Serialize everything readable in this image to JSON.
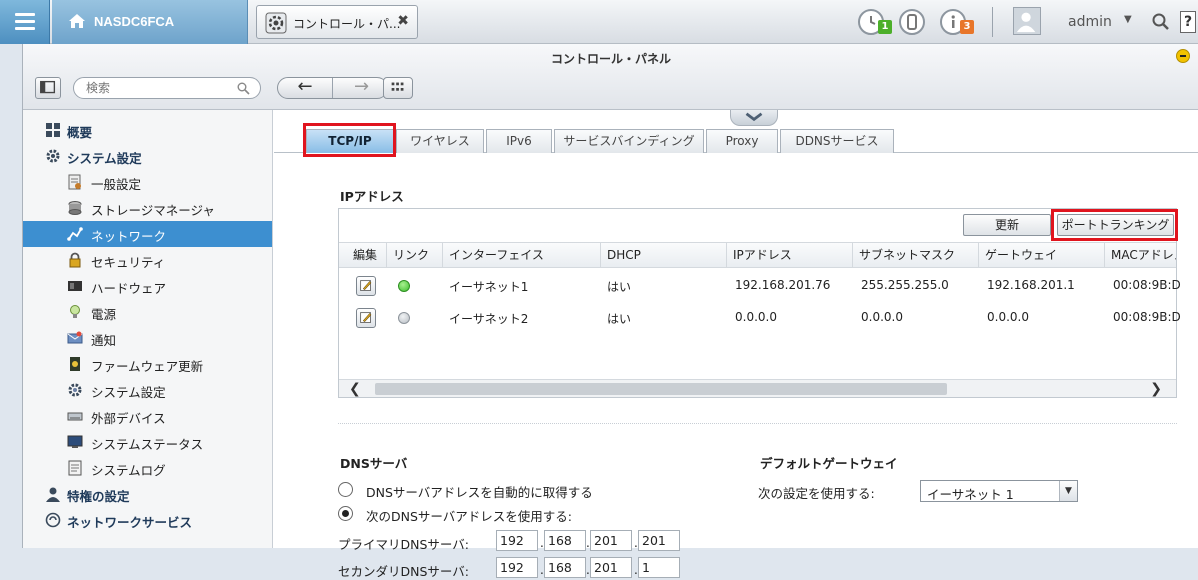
{
  "topbar": {
    "home_title": "NASDC6FCA",
    "app_tab_label": "コントロール・パ...",
    "app_tab_close": "✖",
    "badge_tasks": "1",
    "badge_notifications": "3",
    "user_name": "admin",
    "user_caret": "▼",
    "help": "?"
  },
  "window": {
    "title": "コントロール・パネル",
    "search_placeholder": "検索",
    "nav_back": "←",
    "nav_forward": "→"
  },
  "sidebar": {
    "items": [
      {
        "label": "概要",
        "icon": "overview-icon"
      },
      {
        "label": "システム設定",
        "icon": "gear-icon"
      },
      {
        "label": "一般設定",
        "icon": "general-settings-icon"
      },
      {
        "label": "ストレージマネージャ",
        "icon": "storage-icon"
      },
      {
        "label": "ネットワーク",
        "icon": "network-icon"
      },
      {
        "label": "セキュリティ",
        "icon": "lock-icon"
      },
      {
        "label": "ハードウェア",
        "icon": "hardware-icon"
      },
      {
        "label": "電源",
        "icon": "power-bulb-icon"
      },
      {
        "label": "通知",
        "icon": "notification-icon"
      },
      {
        "label": "ファームウェア更新",
        "icon": "firmware-icon"
      },
      {
        "label": "システム設定",
        "icon": "system-settings-icon"
      },
      {
        "label": "外部デバイス",
        "icon": "external-device-icon"
      },
      {
        "label": "システムステータス",
        "icon": "monitor-icon"
      },
      {
        "label": "システムログ",
        "icon": "log-icon"
      },
      {
        "label": "特権の設定",
        "icon": "user-icon"
      },
      {
        "label": "ネットワークサービス",
        "icon": "network-service-icon"
      }
    ]
  },
  "tabs": [
    "TCP/IP",
    "ワイヤレス",
    "IPv6",
    "サービスバインディング",
    "Proxy",
    "DDNSサービス"
  ],
  "ip_section": {
    "title": "IPアドレス",
    "refresh_button": "更新",
    "trunking_button": "ポートトランキング",
    "columns": [
      "編集",
      "リンク",
      "インターフェイス",
      "DHCP",
      "IPアドレス",
      "サブネットマスク",
      "ゲートウェイ",
      "MACアドレス"
    ],
    "rows": [
      {
        "link": "up",
        "interface": "イーサネット1",
        "dhcp": "はい",
        "ip": "192.168.201.76",
        "subnet": "255.255.255.0",
        "gateway": "192.168.201.1",
        "mac": "00:08:9B:D"
      },
      {
        "link": "down",
        "interface": "イーサネット2",
        "dhcp": "はい",
        "ip": "0.0.0.0",
        "subnet": "0.0.0.0",
        "gateway": "0.0.0.0",
        "mac": "00:08:9B:D"
      }
    ],
    "scroll_left": "❮",
    "scroll_right": "❯"
  },
  "dns": {
    "title": "DNSサーバ",
    "option_auto": "DNSサーバアドレスを自動的に取得する",
    "option_manual": "次のDNSサーバアドレスを使用する:",
    "selected": "manual",
    "primary_label": "プライマリDNSサーバ:",
    "secondary_label": "セカンダリDNSサーバ:",
    "primary": [
      "192",
      "168",
      "201",
      "201"
    ],
    "secondary": [
      "192",
      "168",
      "201",
      "1"
    ]
  },
  "gateway": {
    "title": "デフォルトゲートウェイ",
    "label": "次の設定を使用する:",
    "selected": "イーサネット 1"
  },
  "colors": {
    "accent": "#3d8fd0",
    "highlight_box": "#e0141e",
    "link_up": "#3fbf2f",
    "link_down": "#b8bec4",
    "badge_green": "#4caf2a",
    "badge_orange": "#e8762a"
  }
}
